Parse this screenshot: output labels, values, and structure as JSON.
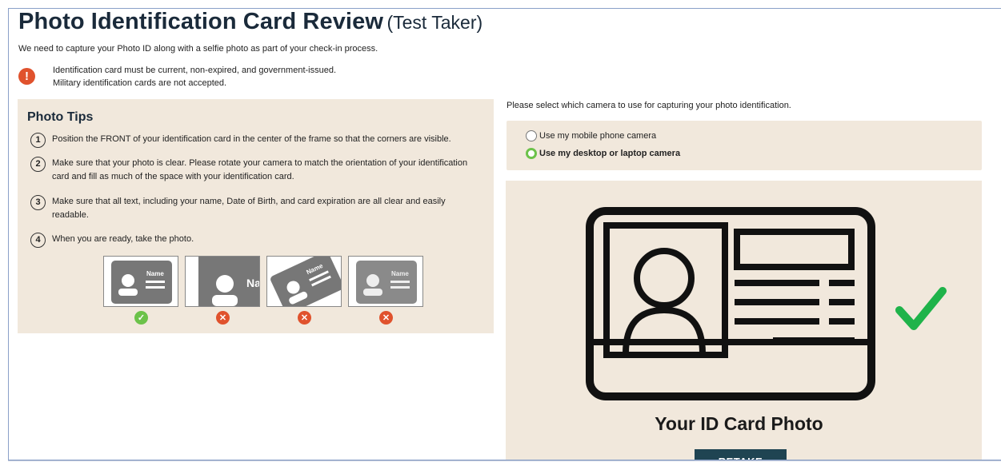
{
  "header": {
    "title": "Photo Identification Card Review",
    "subtitle": "(Test Taker)",
    "intro": "We need to capture your Photo ID along with a selfie photo as part of your check-in process."
  },
  "warning": {
    "icon": "exclamation-icon",
    "color": "#e0522d",
    "line1": "Identification card must be current, non-expired, and government-issued.",
    "line2": "Military identification cards are not accepted."
  },
  "tips": {
    "title": "Photo Tips",
    "items": [
      {
        "num": "1",
        "text": "Position the FRONT of your identification card in the center of the frame so that the corners are visible."
      },
      {
        "num": "2",
        "text": "Make sure that your photo is clear. Please rotate your camera to match the orientation of your identification card and fill as much of the space with your identification card."
      },
      {
        "num": "3",
        "text": "Make sure that all text, including your name, Date of Birth, and card expiration are all clear and easily readable."
      },
      {
        "num": "4",
        "text": "When you are ready, take the photo."
      }
    ],
    "examples": [
      {
        "label": "Name",
        "status": "ok",
        "icon": "check-icon"
      },
      {
        "label": "Na",
        "status": "bad",
        "icon": "close-icon"
      },
      {
        "label": "Name",
        "status": "bad",
        "icon": "close-icon"
      },
      {
        "label": "Name",
        "status": "bad",
        "icon": "close-icon"
      }
    ]
  },
  "camera": {
    "prompt": "Please select which camera to use for capturing your photo identification.",
    "options": [
      {
        "label": "Use my mobile phone camera",
        "selected": false
      },
      {
        "label": "Use my desktop or laptop camera",
        "selected": true
      }
    ]
  },
  "preview": {
    "title": "Your ID Card Photo",
    "retake_label": "RETAKE",
    "check_color": "#1fb34a"
  },
  "colors": {
    "panel_bg": "#f1e8dc",
    "ok": "#6cc24a",
    "bad": "#e0522d",
    "button": "#1f4452"
  }
}
